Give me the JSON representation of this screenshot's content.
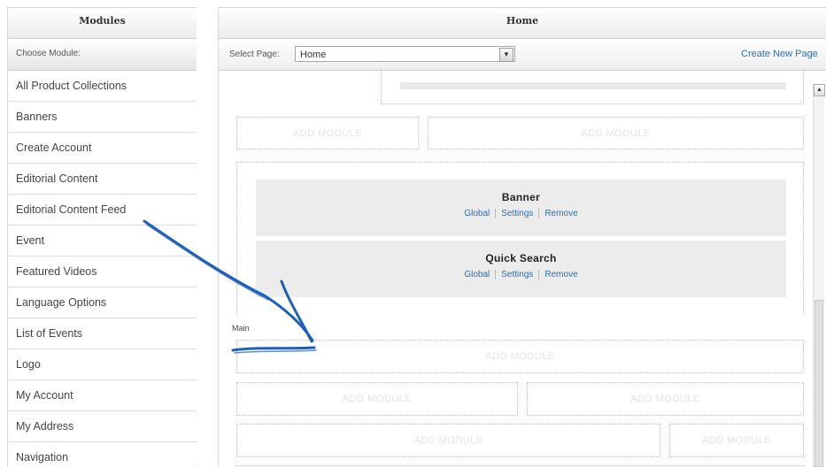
{
  "modules": {
    "title": "Modules",
    "choose_label": "Choose Module:",
    "items": [
      {
        "label": "All Product Collections"
      },
      {
        "label": "Banners"
      },
      {
        "label": "Create Account"
      },
      {
        "label": "Editorial Content"
      },
      {
        "label": "Editorial Content Feed"
      },
      {
        "label": "Event"
      },
      {
        "label": "Featured Videos"
      },
      {
        "label": "Language Options"
      },
      {
        "label": "List of Events"
      },
      {
        "label": "Logo"
      },
      {
        "label": "My Account"
      },
      {
        "label": "My Address"
      },
      {
        "label": "Navigation"
      }
    ]
  },
  "page": {
    "title": "Home",
    "select_label": "Select Page:",
    "selected_page": "Home",
    "create_link": "Create New Page"
  },
  "layout_canvas": {
    "add_module_label": "ADD MODULE",
    "modules": [
      {
        "title": "Banner",
        "links": [
          "Global",
          "Settings",
          "Remove"
        ]
      },
      {
        "title": "Quick Search",
        "links": [
          "Global",
          "Settings",
          "Remove"
        ]
      }
    ],
    "region_label": "Main"
  },
  "icons": {
    "select_dropdown": "chevron-down-icon",
    "scroll_up": "chevron-up-icon",
    "annotation": "hand-drawn-arrow-icon"
  },
  "colors": {
    "link": "#2f6fa8",
    "arrow": "#1f5fb8"
  }
}
